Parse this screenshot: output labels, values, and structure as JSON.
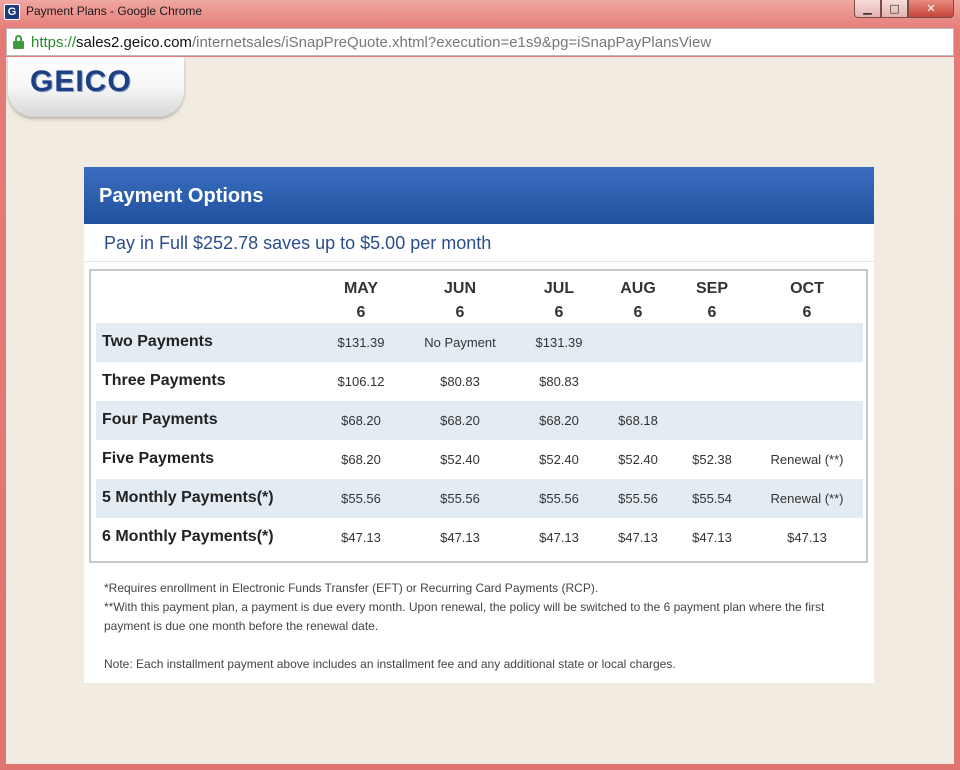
{
  "window": {
    "title": "Payment Plans - Google Chrome",
    "app_icon": "G",
    "minimize_icon": "▁",
    "maximize_icon": "□",
    "close_icon": "✕"
  },
  "address_bar": {
    "scheme": "https://",
    "host": "sales2.geico.com",
    "path": "/internetsales/iSnapPreQuote.xhtml?execution=e1s9&pg=iSnapPayPlansView"
  },
  "logo": {
    "text": "GEICO"
  },
  "panel": {
    "title": "Payment Options",
    "pay_in_full": "Pay in Full $252.78 saves up to $5.00 per month"
  },
  "table": {
    "columns": [
      {
        "month": "MAY",
        "day": "6"
      },
      {
        "month": "JUN",
        "day": "6"
      },
      {
        "month": "JUL",
        "day": "6"
      },
      {
        "month": "AUG",
        "day": "6"
      },
      {
        "month": "SEP",
        "day": "6"
      },
      {
        "month": "OCT",
        "day": "6"
      }
    ],
    "rows": [
      {
        "label": "Two Payments",
        "cells": [
          "$131.39",
          "No Payment",
          "$131.39",
          "",
          "",
          ""
        ]
      },
      {
        "label": "Three Payments",
        "cells": [
          "$106.12",
          "$80.83",
          "$80.83",
          "",
          "",
          ""
        ]
      },
      {
        "label": "Four Payments",
        "cells": [
          "$68.20",
          "$68.20",
          "$68.20",
          "$68.18",
          "",
          ""
        ]
      },
      {
        "label": "Five Payments",
        "cells": [
          "$68.20",
          "$52.40",
          "$52.40",
          "$52.40",
          "$52.38",
          "Renewal (**)"
        ]
      },
      {
        "label": "5 Monthly Payments(*)",
        "cells": [
          "$55.56",
          "$55.56",
          "$55.56",
          "$55.56",
          "$55.54",
          "Renewal (**)"
        ]
      },
      {
        "label": "6 Monthly Payments(*)",
        "cells": [
          "$47.13",
          "$47.13",
          "$47.13",
          "$47.13",
          "$47.13",
          "$47.13"
        ]
      }
    ]
  },
  "footnotes": {
    "eft": "*Requires enrollment in Electronic Funds Transfer (EFT) or Recurring Card Payments (RCP).",
    "renewal": "**With this payment plan, a payment is due every month. Upon renewal, the policy will be switched to the 6 payment plan where the first payment is due one month before the renewal date.",
    "note": "Note: Each installment payment above includes an installment fee and any additional state or local charges."
  },
  "colors": {
    "header_blue": "#20519e",
    "row_shade": "#e4ecf3",
    "page_bg": "#f1ebe1",
    "logo_blue": "#1f3f84"
  }
}
